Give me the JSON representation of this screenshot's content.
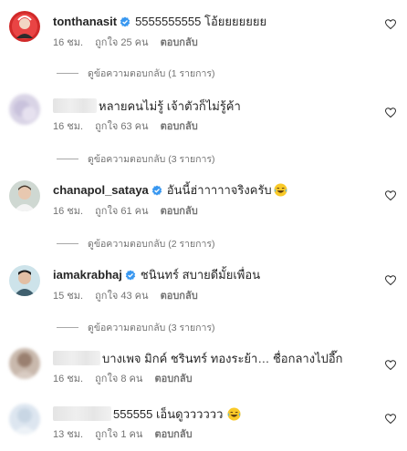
{
  "comments": [
    {
      "username": "tonthanasit",
      "verified": true,
      "text": "5555555555 โอ้ยยยยยยย",
      "time": "16 ชม.",
      "likes": "ถูกใจ 25 คน",
      "reply": "ตอบกลับ",
      "view_replies": "ดูข้อความตอบกลับ (1 รายการ)"
    },
    {
      "username": "",
      "verified": false,
      "text": "หลายคนไม่รู้ เจ้าตัวก็ไม่รู้ค้า",
      "time": "16 ชม.",
      "likes": "ถูกใจ 63 คน",
      "reply": "ตอบกลับ",
      "view_replies": "ดูข้อความตอบกลับ (3 รายการ)"
    },
    {
      "username": "chanapol_sataya",
      "verified": true,
      "text": "อันนี้ฮ่าาาาาจริงครับ",
      "time": "16 ชม.",
      "likes": "ถูกใจ 61 คน",
      "reply": "ตอบกลับ",
      "view_replies": "ดูข้อความตอบกลับ (2 รายการ)"
    },
    {
      "username": "iamakrabhaj",
      "verified": true,
      "text": "ชนินทร์ สบายดีมั้ยเพื่อน",
      "time": "15 ชม.",
      "likes": "ถูกใจ 43 คน",
      "reply": "ตอบกลับ",
      "view_replies": "ดูข้อความตอบกลับ (3 รายการ)"
    },
    {
      "username": "",
      "verified": false,
      "text": "บางเพจ มิกค์ ชรินทร์ ทองระย้า… ชื่อกลางไปอี๊ก",
      "time": "16 ชม.",
      "likes": "ถูกใจ 8 คน",
      "reply": "ตอบกลับ"
    },
    {
      "username": "",
      "verified": false,
      "text": "555555 เอ็นดูวววววว",
      "time": "13 ชม.",
      "likes": "ถูกใจ 1 คน",
      "reply": "ตอบกลับ"
    }
  ],
  "colors": {
    "verified": "#3897f0",
    "muted": "#737373",
    "text": "#262626"
  }
}
